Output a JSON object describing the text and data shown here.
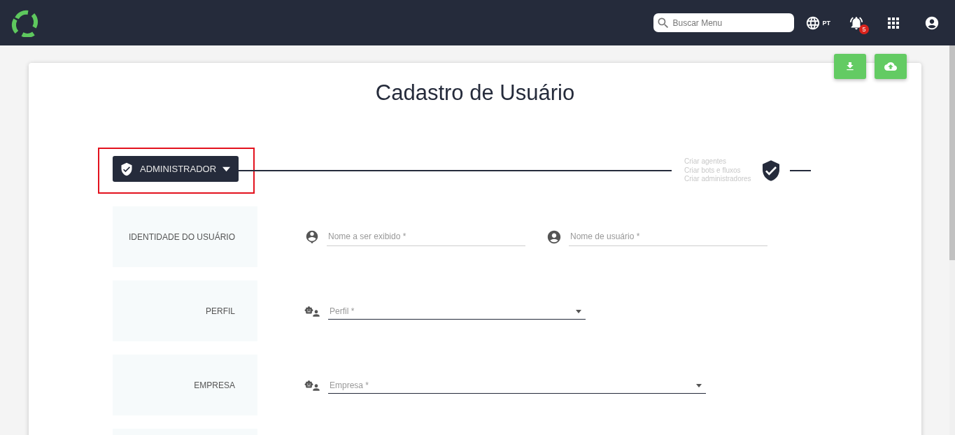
{
  "header": {
    "search": {
      "placeholder": "Buscar Menu"
    },
    "language": "PT",
    "notifications": {
      "count": "5"
    }
  },
  "title": "Cadastro de Usuário",
  "role_dropdown": {
    "label": "ADMINISTRADOR",
    "highlighted": true
  },
  "permissions": [
    "Criar agentes",
    "Criar bots e fluxos",
    "Criar administradores"
  ],
  "sections": [
    {
      "label": "IDENTIDADE DO USUÁRIO",
      "fields": [
        {
          "kind": "text",
          "placeholder": "Nome a ser exibido *"
        },
        {
          "kind": "text",
          "placeholder": "Nome de usuário *"
        }
      ]
    },
    {
      "label": "PERFIL",
      "fields": [
        {
          "kind": "select",
          "placeholder": "Perfil *"
        }
      ]
    },
    {
      "label": "EMPRESA",
      "fields": [
        {
          "kind": "select",
          "placeholder": "Empresa *"
        }
      ]
    }
  ]
}
